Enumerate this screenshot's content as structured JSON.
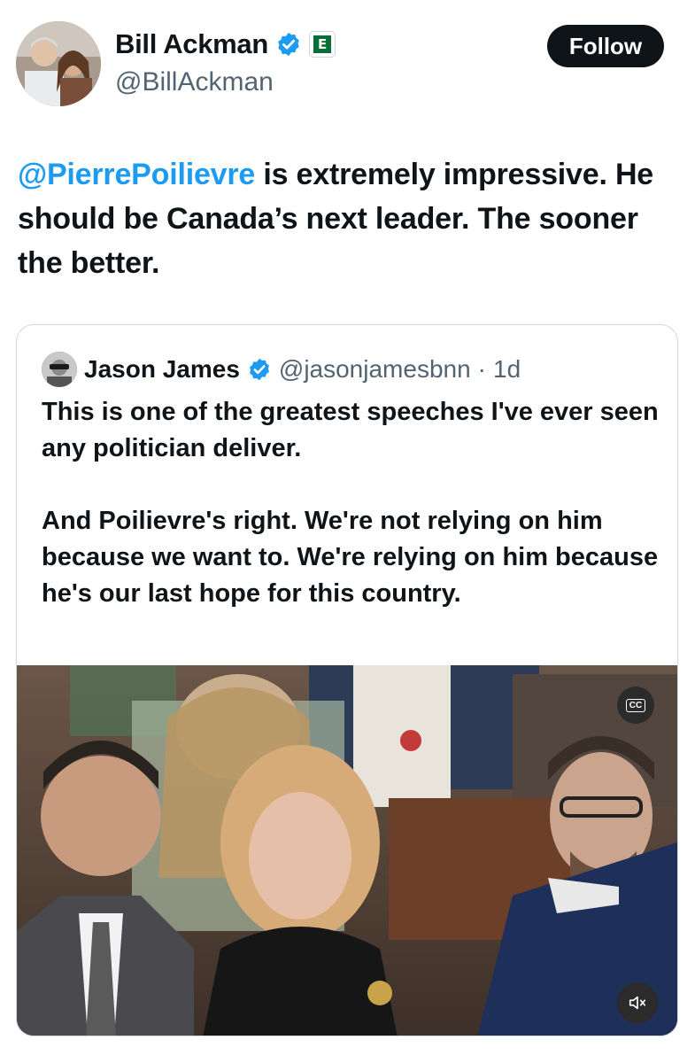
{
  "author": {
    "name": "Bill Ackman",
    "handle": "@BillAckman",
    "avatar_icon": "profile-photo",
    "verified_icon": "verified-badge-icon",
    "org_badge_icon": "organization-badge-icon"
  },
  "follow_button": {
    "label": "Follow"
  },
  "tweet": {
    "mention": "@PierrePoilievre",
    "text": " is extremely impressive. He should be Canada’s next leader. The sooner the better."
  },
  "quoted_tweet": {
    "name": "Jason James",
    "handle": "@jasonjamesbnn",
    "separator": "·",
    "time": "1d",
    "text": "This is one of the greatest speeches I've ever seen any politician deliver.\n\nAnd Poilievre's right. We're not relying on him because we want to. We're relying on him because he's our last hope for this country.",
    "media": {
      "captions_label": "CC",
      "mute_icon": "speaker-muted-icon"
    }
  },
  "colors": {
    "accent": "#1d9bf0",
    "text": "#0f1419",
    "secondary": "#536471",
    "border": "#cfd9de"
  }
}
